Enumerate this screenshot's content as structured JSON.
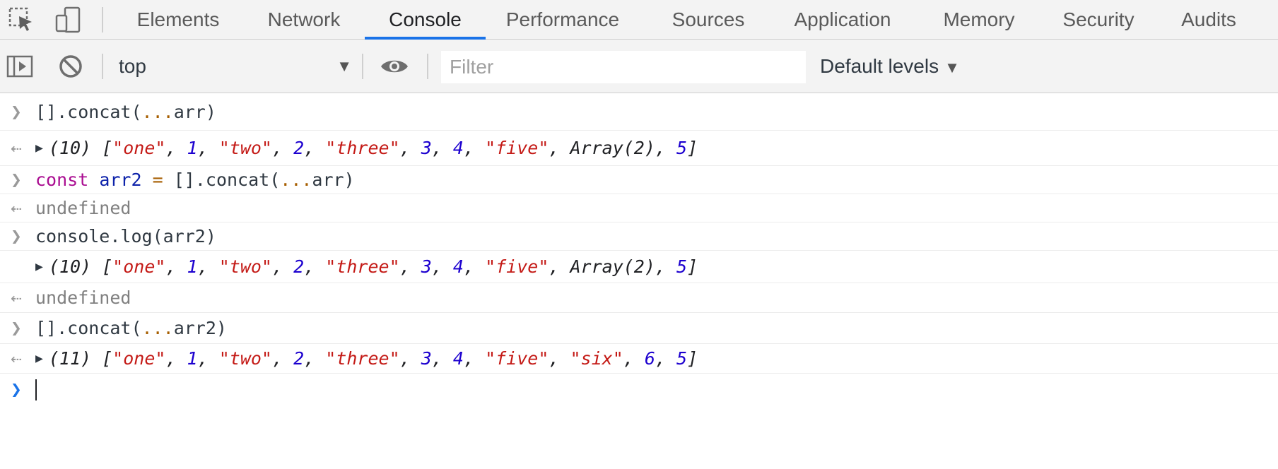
{
  "tabs": [
    {
      "label": "Elements",
      "active": false
    },
    {
      "label": "Network",
      "active": false
    },
    {
      "label": "Console",
      "active": true
    },
    {
      "label": "Performance",
      "active": false
    },
    {
      "label": "Sources",
      "active": false
    },
    {
      "label": "Application",
      "active": false
    },
    {
      "label": "Memory",
      "active": false
    },
    {
      "label": "Security",
      "active": false
    },
    {
      "label": "Audits",
      "active": false
    }
  ],
  "toolbar": {
    "context": "top",
    "filter_placeholder": "Filter",
    "levels": "Default levels"
  },
  "console": {
    "r1": {
      "code": "[].concat(...arr)"
    },
    "r2": {
      "count": "(10)",
      "items": [
        "\"one\"",
        "1",
        "\"two\"",
        "2",
        "\"three\"",
        "3",
        "4",
        "\"five\"",
        "Array(2)",
        "5"
      ]
    },
    "r3": {
      "code": "const arr2 = [].concat(...arr)"
    },
    "r4": {
      "text": "undefined"
    },
    "r5": {
      "code": "console.log(arr2)"
    },
    "r6": {
      "count": "(10)",
      "items": [
        "\"one\"",
        "1",
        "\"two\"",
        "2",
        "\"three\"",
        "3",
        "4",
        "\"five\"",
        "Array(2)",
        "5"
      ]
    },
    "r7": {
      "text": "undefined"
    },
    "r8": {
      "code": "[].concat(...arr2)"
    },
    "r9": {
      "count": "(11)",
      "items": [
        "\"one\"",
        "1",
        "\"two\"",
        "2",
        "\"three\"",
        "3",
        "4",
        "\"five\"",
        "\"six\"",
        "6",
        "5"
      ]
    }
  },
  "colors": {
    "accent": "#1a73e8",
    "string": "#c41a16",
    "number": "#1c00cf",
    "keyword": "#aa0d91"
  }
}
